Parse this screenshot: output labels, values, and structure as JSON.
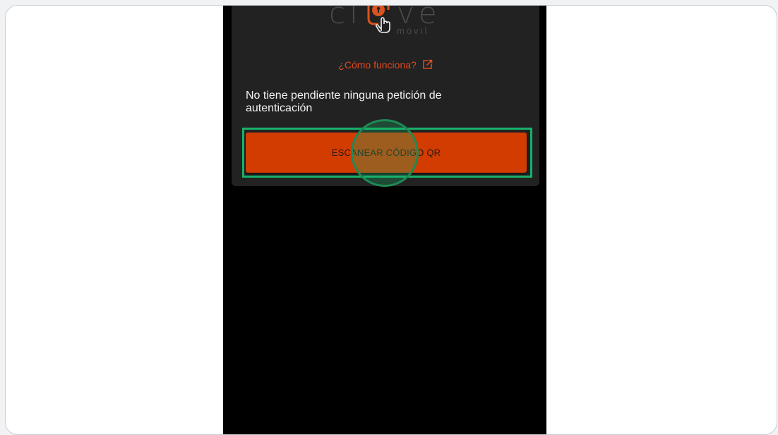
{
  "app": {
    "logo_text_left": "cl",
    "logo_text_right": "ve",
    "logo_subtext": "móvil",
    "help_link": "¿Cómo funciona?",
    "status_message": "No tiene pendiente ninguna petición de autenticación",
    "scan_button_label": "ESCANEAR CÓDIGO QR"
  },
  "colors": {
    "accent": "#d23c00",
    "link": "#e0491d",
    "card_background": "#222222",
    "phone_background": "#000000",
    "highlight": "#17b26a"
  },
  "icons": {
    "logo_mark": "lock-hand-icon",
    "external_link": "external-link-icon"
  }
}
